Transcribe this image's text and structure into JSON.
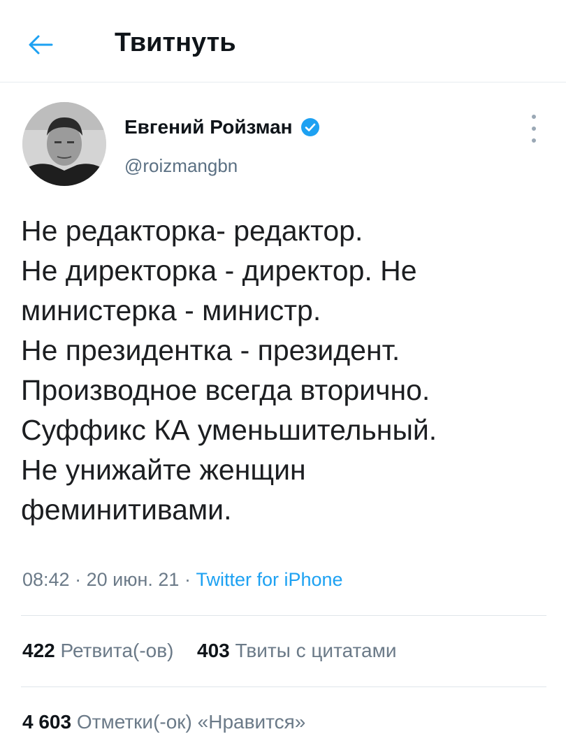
{
  "header": {
    "title": "Твитнуть"
  },
  "author": {
    "name": "Евгений Ройзман",
    "handle": "@roizmangbn"
  },
  "tweet": {
    "lines": [
      "Не редакторка- редактор.",
      "Не директорка - директор. Не",
      "министерка - министр.",
      "Не президентка - президент.",
      "Производное всегда вторично.",
      "Суффикс КА уменьшительный.",
      "Не унижайте женщин",
      "феминитивами."
    ],
    "time": "08:42",
    "date": "20 июн. 21",
    "separator": "·",
    "source": "Twitter for iPhone"
  },
  "stats": {
    "retweets_count": "422",
    "retweets_label": "Ретвита(-ов)",
    "quotes_count": "403",
    "quotes_label": "Твиты с цитатами",
    "likes_count": "4 603",
    "likes_label": "Отметки(-ок) «Нравится»"
  },
  "colors": {
    "accent": "#1da1f2",
    "text": "#0f1419",
    "secondary": "#6b7a88"
  }
}
